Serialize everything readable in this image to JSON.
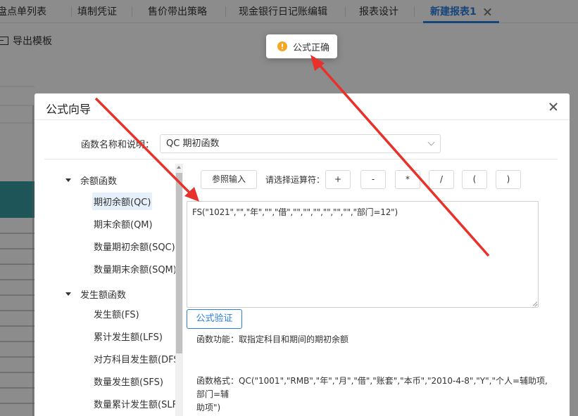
{
  "tabs": [
    {
      "label": "盘点单列表",
      "active": false
    },
    {
      "label": "填制凭证",
      "active": false
    },
    {
      "label": "售价带出策略",
      "active": false
    },
    {
      "label": "现金银行日记账编辑",
      "active": false
    },
    {
      "label": "报表设计",
      "active": false
    },
    {
      "label": "新建报表1",
      "active": true
    }
  ],
  "toolbar": {
    "export_label": "导出模板"
  },
  "toast": {
    "message": "公式正确",
    "icon": "warning-icon",
    "color": "#f5a623"
  },
  "dialog": {
    "title": "公式向导",
    "function_label": "函数名称和说明：",
    "function_value": "QC 期初函数",
    "tree": [
      {
        "group": "余额函数",
        "items": [
          "期初余额(QC)",
          "期末余额(QM)",
          "数量期初余额(SQC)",
          "数量期末余额(SQM)"
        ]
      },
      {
        "group": "发生额函数",
        "items": [
          "发生额(FS)",
          "累计发生额(LFS)",
          "对方科目发生额(DFS)",
          "数量发生额(SFS)",
          "数量累计发生额(SLFS"
        ]
      }
    ],
    "selected_item": "期初余额(QC)",
    "reference_input_label": "参照输入",
    "operator_label": "请选择运算符：",
    "operators": [
      "+",
      "-",
      "*",
      "/",
      "(",
      ")"
    ],
    "formula_text": "FS(\"1021\",\"\",\"年\",\"\",\"借\",\"\",\"\",\"\",\"\",\"\",\"\",\"部门=12\")",
    "verify_label": "公式验证",
    "description": "函数功能：取指定科目和期间的期初余额",
    "format_line1": "函数格式：QC(\"1001\",\"RMB\",\"年\",\"月\",\"借\",\"账套\",\"本币\",\"2010-4-8\",\"Y\",\"个人=辅助项,部门=辅",
    "format_line2": "助项\")"
  },
  "colors": {
    "accent": "#2a7de1",
    "arrow": "#e8312a",
    "header_teal": "#1f8a8f"
  }
}
